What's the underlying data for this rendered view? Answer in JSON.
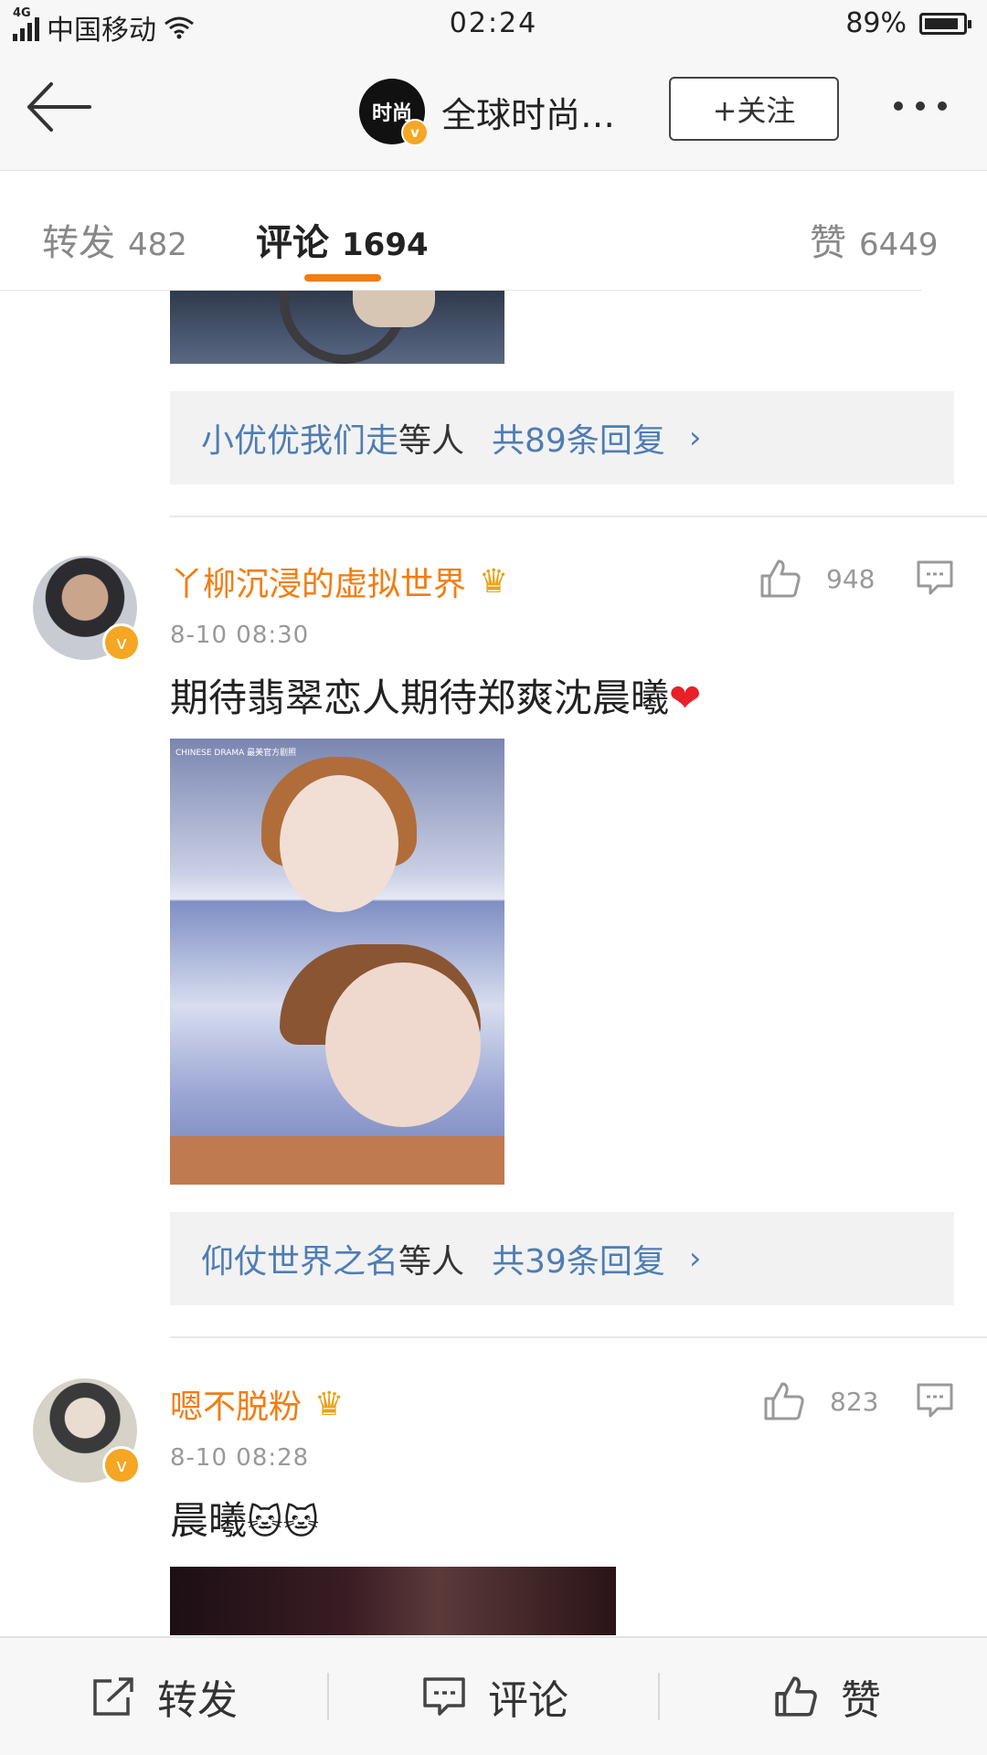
{
  "status_bar": {
    "network": "4G",
    "carrier": "中国移动",
    "time": "02:24",
    "battery_percent": "89%",
    "battery_level": 0.89
  },
  "nav": {
    "back_icon": "arrow-left-icon",
    "account_avatar_text": "时尚",
    "account_name": "全球时尚…",
    "follow_label": "+关注",
    "more_icon": "more-dots-icon"
  },
  "tabs": [
    {
      "label": "转发",
      "count": "482"
    },
    {
      "label": "评论",
      "count": "1694"
    },
    {
      "label": "赞",
      "count": "6449"
    }
  ],
  "replies_block_1": {
    "who": "小优优我们走",
    "etc": "等人",
    "total": "共89条回复",
    "chevron": "›"
  },
  "comments": [
    {
      "username": "丫柳沉浸的虚拟世界",
      "time": "8-10 08:30",
      "likes": "948",
      "text": "期待翡翠恋人期待郑爽沈晨曦",
      "heart": "❤",
      "image_watermark": "CHINESE DRAMA 最美官方剧照",
      "replies": {
        "who": "仰仗世界之名",
        "etc": "等人",
        "total": "共39条回复",
        "chevron": "›"
      }
    },
    {
      "username": "嗯不脱粉",
      "time": "8-10 08:28",
      "likes": "823",
      "text": "晨曦",
      "emoji": "🐱🐱"
    }
  ],
  "bottom_bar": {
    "repost_label": "转发",
    "comment_label": "评论",
    "like_label": "赞"
  },
  "colors": {
    "accent_orange": "#f47c10",
    "link_blue": "#4f7db3",
    "vip_gold": "#f5a623"
  }
}
